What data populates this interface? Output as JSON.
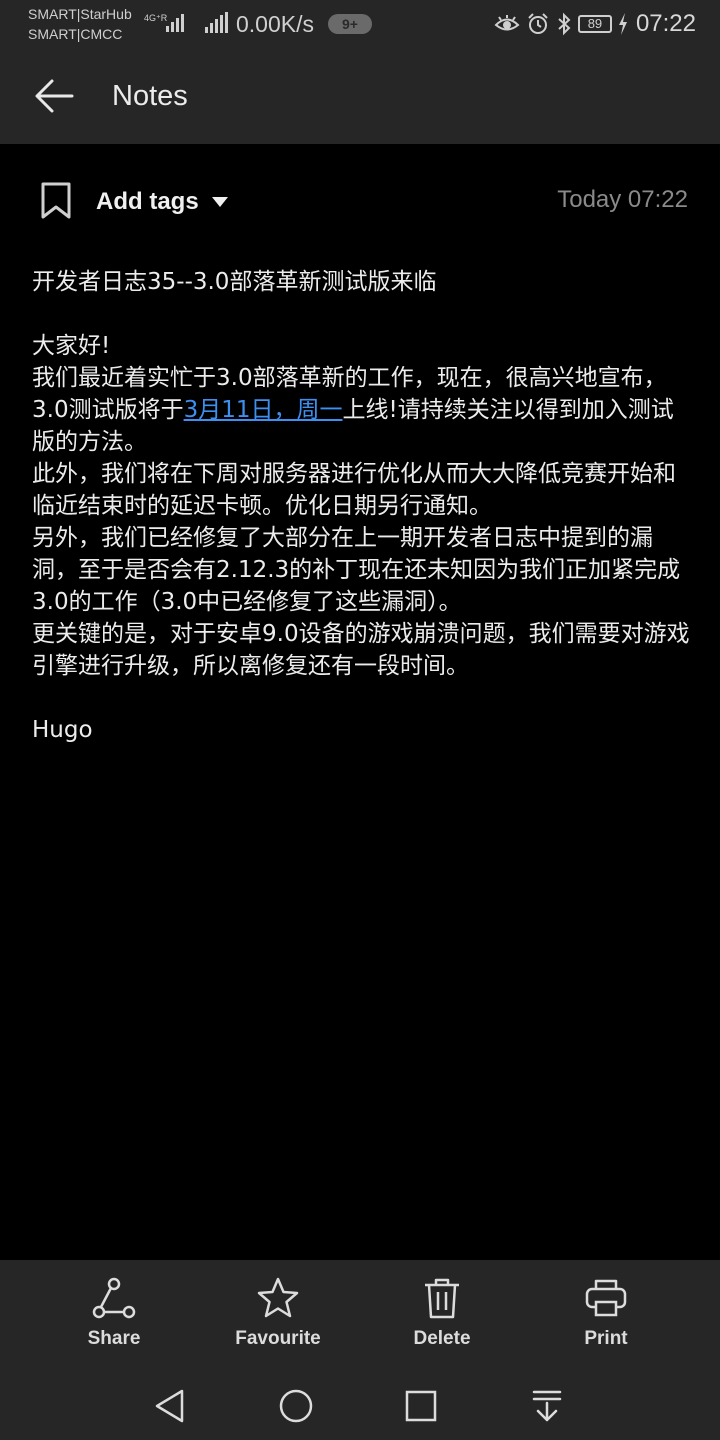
{
  "status_bar": {
    "carrier_1": "SMART|StarHub",
    "carrier_2": "SMART|CMCC",
    "network_type": "4G⁺R",
    "speed": "0.00K/s",
    "notification_badge": "9+",
    "battery_level": "89",
    "time": "07:22"
  },
  "app_bar": {
    "title": "Notes"
  },
  "note": {
    "tags_label": "Add tags",
    "timestamp": "Today 07:22",
    "title": "开发者日志35--3.0部落革新测试版来临",
    "greeting": "大家好!",
    "p1_before": "我们最近着实忙于3.0部落革新的工作，现在，很高兴地宣布，3.0测试版将于",
    "p1_link": "3月11日，周一",
    "p1_after": "上线!请持续关注以得到加入测试版的方法。",
    "p2": "此外，我们将在下周对服务器进行优化从而大大降低竞赛开始和临近结束时的延迟卡顿。优化日期另行通知。",
    "p3": "另外，我们已经修复了大部分在上一期开发者日志中提到的漏洞，至于是否会有2.12.3的补丁现在还未知因为我们正加紧完成3.0的工作（3.0中已经修复了这些漏洞）。",
    "p4": "更关键的是，对于安卓9.0设备的游戏崩溃问题，我们需要对游戏引擎进行升级，所以离修复还有一段时间。",
    "signature": "Hugo"
  },
  "actions": {
    "share": "Share",
    "favourite": "Favourite",
    "delete": "Delete",
    "print": "Print"
  },
  "colors": {
    "bar_bg": "#262626",
    "background": "#000000",
    "link": "#3d8ff0",
    "timestamp": "#8a8a8a"
  }
}
